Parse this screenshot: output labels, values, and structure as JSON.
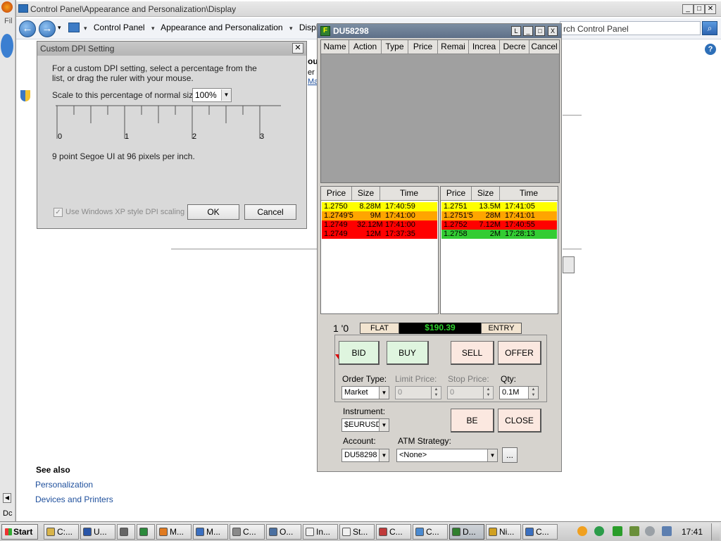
{
  "control_panel": {
    "title": "Control Panel\\Appearance and Personalization\\Display",
    "breadcrumb": [
      "Control Panel",
      "Appearance and Personalization",
      "Display"
    ],
    "search_placeholder": "rch Control Panel",
    "see_also_title": "See also",
    "see_also_links": [
      "Personalization",
      "Devices and Printers"
    ],
    "partial_text_1": "ou",
    "partial_text_2": "er",
    "partial_link": "Ma"
  },
  "dpi_dialog": {
    "title": "Custom DPI Setting",
    "description": "For a custom DPI setting, select a percentage from the list, or drag the ruler with your mouse.",
    "scale_label": "Scale to this percentage of normal size:",
    "scale_value": "100%",
    "ruler_labels": [
      "0",
      "1",
      "2",
      "3"
    ],
    "font_info": "9 point Segoe UI at 96 pixels per inch.",
    "xp_scaling_label": "Use Windows XP style DPI scaling",
    "xp_scaling_checked": true,
    "ok_label": "OK",
    "cancel_label": "Cancel"
  },
  "dom_window": {
    "title": "DU58298",
    "title_buttons": [
      "L",
      "_",
      "□",
      "X"
    ],
    "orders_columns": [
      "Name",
      "Action",
      "Type",
      "Price",
      "Remai",
      "Increa",
      "Decre",
      "Cancel"
    ],
    "bid_book": {
      "columns": [
        "Price",
        "Size",
        "Time"
      ],
      "rows": [
        {
          "price": "1.2750",
          "size": "8.28M",
          "time": "17:40:59",
          "color": "#ffff00"
        },
        {
          "price": "1.2749'5",
          "size": "9M",
          "time": "17:41:00",
          "color": "#ffa500"
        },
        {
          "price": "1.2749",
          "size": "32.12M",
          "time": "17:41:00",
          "color": "#ff0000"
        },
        {
          "price": "1.2749",
          "size": "12M",
          "time": "17:37:35",
          "color": "#ff0000"
        }
      ]
    },
    "ask_book": {
      "columns": [
        "Price",
        "Size",
        "Time"
      ],
      "rows": [
        {
          "price": "1.2751",
          "size": "13.5M",
          "time": "17:41:05",
          "color": "#ffff00"
        },
        {
          "price": "1.2751'5",
          "size": "28M",
          "time": "17:41:01",
          "color": "#ffa500"
        },
        {
          "price": "1.2752",
          "size": "7.12M",
          "time": "17:40:55",
          "color": "#ff0000"
        },
        {
          "price": "1.2758",
          "size": "2M",
          "time": "17:28:13",
          "color": "#33cc33"
        }
      ]
    },
    "position": "1 '0",
    "flat_label": "FLAT",
    "pnl": "$190.39",
    "entry_label": "ENTRY",
    "buttons": {
      "bid": "BID",
      "buy": "BUY",
      "sell": "SELL",
      "offer": "OFFER",
      "be": "BE",
      "close": "CLOSE",
      "more": "..."
    },
    "order_type_label": "Order Type:",
    "order_type_value": "Market",
    "limit_price_label": "Limit Price:",
    "limit_price_value": "0",
    "stop_price_label": "Stop Price:",
    "stop_price_value": "0",
    "qty_label": "Qty:",
    "qty_value": "0.1M",
    "instrument_label": "Instrument:",
    "instrument_value": "$EURUSD",
    "account_label": "Account:",
    "account_value": "DU58298",
    "atm_label": "ATM Strategy:",
    "atm_value": "<None>"
  },
  "taskbar": {
    "start_label": "Start",
    "tasks": [
      "C:...",
      "U...",
      "",
      "",
      "M...",
      "M...",
      "C...",
      "O...",
      "In...",
      "St...",
      "C...",
      "C...",
      "D...",
      "Ni...",
      "C..."
    ],
    "clock": "17:41"
  },
  "left_strip": {
    "label_1": "Fil",
    "label_2": "Dc"
  },
  "colors": {
    "bid_green": "#dff5df",
    "sell_peach": "#fbe8e0",
    "pnl_green": "#2ed12e",
    "title_blue": "#5e7088"
  }
}
